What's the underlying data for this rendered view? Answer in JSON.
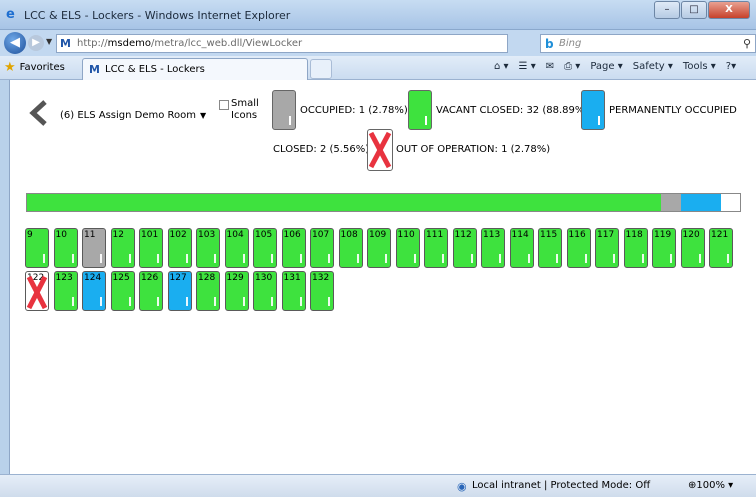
{
  "window": {
    "title": "LCC & ELS - Lockers - Windows Internet Explorer",
    "buttons": [
      "–",
      "□",
      "X"
    ]
  },
  "address": {
    "url_prefix": "http://",
    "url_host": "msdemo",
    "url_path": "/metra/lcc_web.dll/ViewLocker",
    "search_placeholder": "Bing"
  },
  "favorites": {
    "label": "Favorites",
    "tab_label": "LCC & ELS - Lockers",
    "commands": [
      "Page ▾",
      "Safety ▾",
      "Tools ▾",
      "?▾"
    ]
  },
  "controls": {
    "room_select": "(6) ELS Assign Demo Room",
    "small_icons_label": "Small Icons"
  },
  "legend": {
    "occupied": "OCCUPIED: 1 (2.78%)",
    "vacant_closed": "VACANT CLOSED: 32 (88.89%)",
    "permanently_occupied": "PERMANENTLY OCCUPIED",
    "closed": "CLOSED: 2 (5.56%)",
    "out_of_operation": "OUT OF OPERATION: 1 (2.78%)"
  },
  "colors": {
    "vacant": "#3ee23e",
    "occupied": "#a8a8a8",
    "permanent": "#1aaef0",
    "x_mark": "#e8333f"
  },
  "progress": {
    "vacant_fraction": 0.889,
    "occupied_fraction": 0.028,
    "permanent_fraction": 0.056
  },
  "lockers": [
    {
      "num": "9",
      "state": "vacant"
    },
    {
      "num": "10",
      "state": "vacant"
    },
    {
      "num": "11",
      "state": "occupied"
    },
    {
      "num": "12",
      "state": "vacant"
    },
    {
      "num": "101",
      "state": "vacant"
    },
    {
      "num": "102",
      "state": "vacant"
    },
    {
      "num": "103",
      "state": "vacant"
    },
    {
      "num": "104",
      "state": "vacant"
    },
    {
      "num": "105",
      "state": "vacant"
    },
    {
      "num": "106",
      "state": "vacant"
    },
    {
      "num": "107",
      "state": "vacant"
    },
    {
      "num": "108",
      "state": "vacant"
    },
    {
      "num": "109",
      "state": "vacant"
    },
    {
      "num": "110",
      "state": "vacant"
    },
    {
      "num": "111",
      "state": "vacant"
    },
    {
      "num": "112",
      "state": "vacant"
    },
    {
      "num": "113",
      "state": "vacant"
    },
    {
      "num": "114",
      "state": "vacant"
    },
    {
      "num": "115",
      "state": "vacant"
    },
    {
      "num": "116",
      "state": "vacant"
    },
    {
      "num": "117",
      "state": "vacant"
    },
    {
      "num": "118",
      "state": "vacant"
    },
    {
      "num": "119",
      "state": "vacant"
    },
    {
      "num": "120",
      "state": "vacant"
    },
    {
      "num": "121",
      "state": "vacant"
    },
    {
      "num": "122",
      "state": "out"
    },
    {
      "num": "123",
      "state": "vacant"
    },
    {
      "num": "124",
      "state": "permanent"
    },
    {
      "num": "125",
      "state": "vacant"
    },
    {
      "num": "126",
      "state": "vacant"
    },
    {
      "num": "127",
      "state": "permanent"
    },
    {
      "num": "128",
      "state": "vacant"
    },
    {
      "num": "129",
      "state": "vacant"
    },
    {
      "num": "130",
      "state": "vacant"
    },
    {
      "num": "131",
      "state": "vacant"
    },
    {
      "num": "132",
      "state": "vacant"
    }
  ],
  "status": {
    "zone": "Local intranet | Protected Mode: Off",
    "zoom": "100%"
  }
}
